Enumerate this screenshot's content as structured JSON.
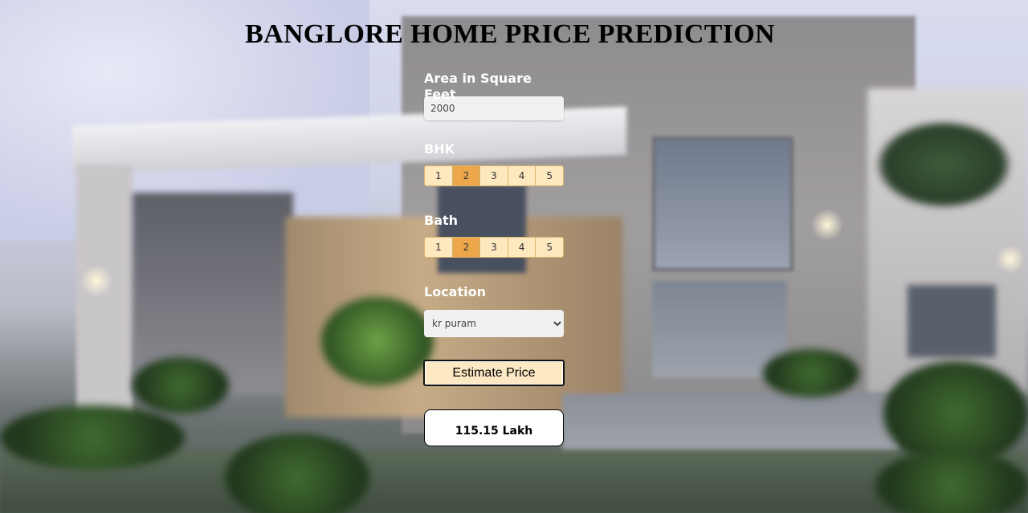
{
  "title": "BANGLORE HOME PRICE PREDICTION",
  "area": {
    "label": "Area in Square Feet",
    "value": "2000"
  },
  "bhk": {
    "label": "BHK",
    "options": [
      "1",
      "2",
      "3",
      "4",
      "5"
    ],
    "selected": "2"
  },
  "bath": {
    "label": "Bath",
    "options": [
      "1",
      "2",
      "3",
      "4",
      "5"
    ],
    "selected": "2"
  },
  "location": {
    "label": "Location",
    "selected": "kr puram"
  },
  "estimate_button": "Estimate Price",
  "result": "115.15 Lakh",
  "colors": {
    "toggle_bg": "#fde8bf",
    "toggle_selected": "#eba74a",
    "button_bg": "#fde8c4"
  }
}
